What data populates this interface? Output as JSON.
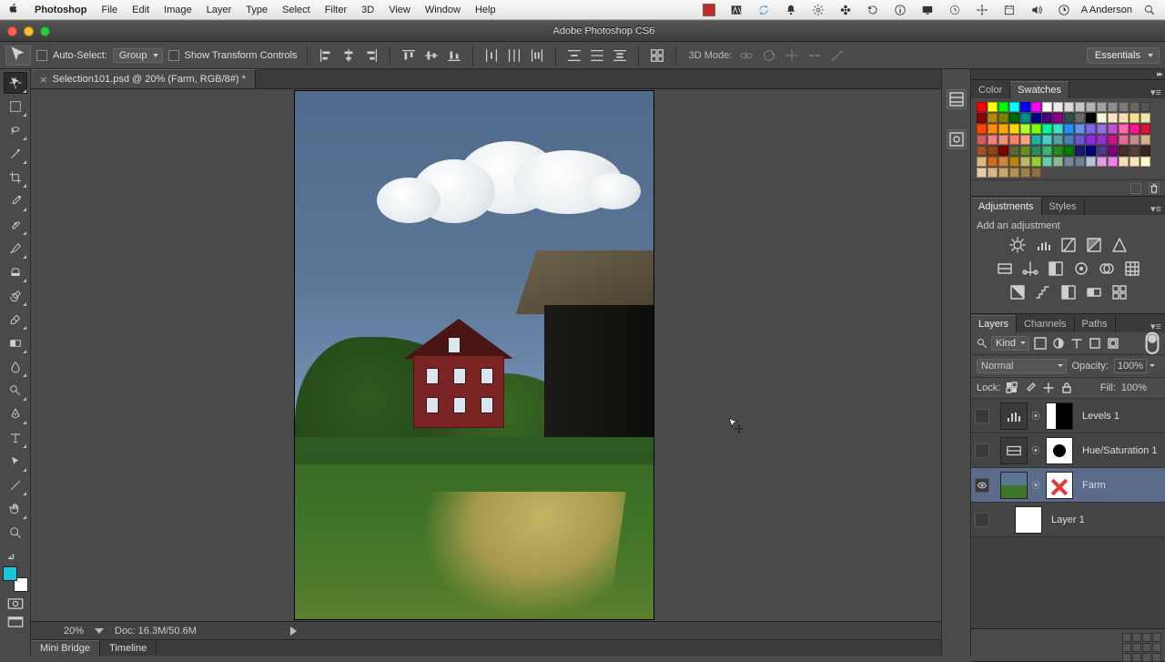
{
  "mac_menu": {
    "app_name": "Photoshop",
    "items": [
      "File",
      "Edit",
      "Image",
      "Layer",
      "Type",
      "Select",
      "Filter",
      "3D",
      "View",
      "Window",
      "Help"
    ],
    "user": "A Anderson"
  },
  "window": {
    "title": "Adobe Photoshop CS6"
  },
  "options_bar": {
    "auto_select_label": "Auto-Select:",
    "auto_select_target": "Group",
    "show_transform_label": "Show Transform Controls",
    "mode3d_label": "3D Mode:"
  },
  "workspace_switcher": "Essentials",
  "document": {
    "tab_title": "Selection101.psd @ 20% (Farm, RGB/8#) *",
    "zoom": "20%",
    "doc_size": "Doc: 16.3M/50.6M"
  },
  "bottom_tabs": [
    "Mini Bridge",
    "Timeline"
  ],
  "panels": {
    "color_tabs": [
      "Color",
      "Swatches"
    ],
    "adjustments_tabs": [
      "Adjustments",
      "Styles"
    ],
    "adjustments_hint": "Add an adjustment",
    "layers_tabs": [
      "Layers",
      "Channels",
      "Paths"
    ],
    "layer_filter_kind": "Kind",
    "blend_mode": "Normal",
    "opacity_label": "Opacity:",
    "opacity_value": "100%",
    "lock_label": "Lock:",
    "fill_label": "Fill:",
    "fill_value": "100%",
    "layers": [
      {
        "name": "Levels 1",
        "visible": false,
        "type": "levels",
        "mask": "split"
      },
      {
        "name": "Hue/Saturation 1",
        "visible": false,
        "type": "huesat",
        "mask": "whitehole"
      },
      {
        "name": "Farm",
        "visible": true,
        "type": "image",
        "mask": "disabled",
        "selected": true
      },
      {
        "name": "Layer 1",
        "visible": false,
        "type": "image",
        "mask": "white"
      }
    ]
  },
  "swatch_colors": [
    "#ff0000",
    "#ffff00",
    "#00ff00",
    "#00ffff",
    "#0000ff",
    "#ff00ff",
    "#ffffff",
    "#ececec",
    "#d9d9d9",
    "#c6c6c6",
    "#b3b3b3",
    "#a0a0a0",
    "#8d8d8d",
    "#7a7a7a",
    "#676767",
    "#545454",
    "#8b0000",
    "#b8860b",
    "#808000",
    "#006400",
    "#008b8b",
    "#00008b",
    "#4b0082",
    "#8b008b",
    "#2f4f4f",
    "#696969",
    "#000000",
    "#f5f5dc",
    "#ffe4c4",
    "#ffdead",
    "#f0e68c",
    "#eee8aa",
    "#ff4500",
    "#ff8c00",
    "#ffa500",
    "#ffd700",
    "#adff2f",
    "#7fff00",
    "#00fa9a",
    "#40e0d0",
    "#1e90ff",
    "#6495ed",
    "#7b68ee",
    "#9370db",
    "#ba55d3",
    "#ff69b4",
    "#ff1493",
    "#dc143c",
    "#cd5c5c",
    "#f08080",
    "#e9967a",
    "#fa8072",
    "#ffa07a",
    "#20b2aa",
    "#48d1cc",
    "#5f9ea0",
    "#4682b4",
    "#6a5acd",
    "#8a2be2",
    "#9932cc",
    "#c71585",
    "#db7093",
    "#bc8f8f",
    "#d2b48c",
    "#a0522d",
    "#8b4513",
    "#800000",
    "#556b2f",
    "#6b8e23",
    "#2e8b57",
    "#3cb371",
    "#228b22",
    "#008000",
    "#191970",
    "#000080",
    "#483d8b",
    "#800080",
    "#4a2c2a",
    "#5d4037",
    "#3e2723",
    "#deb887",
    "#d2691e",
    "#cd853f",
    "#b8860b",
    "#bdb76b",
    "#9acd32",
    "#66cdaa",
    "#8fbc8f",
    "#778899",
    "#708090",
    "#b0c4de",
    "#dda0dd",
    "#ee82ee",
    "#f5deb3",
    "#ffe4b5",
    "#fffacd",
    "#e6cba8",
    "#d9b98c",
    "#c9a66b",
    "#b18f55",
    "#a08050",
    "#8c6d46"
  ]
}
